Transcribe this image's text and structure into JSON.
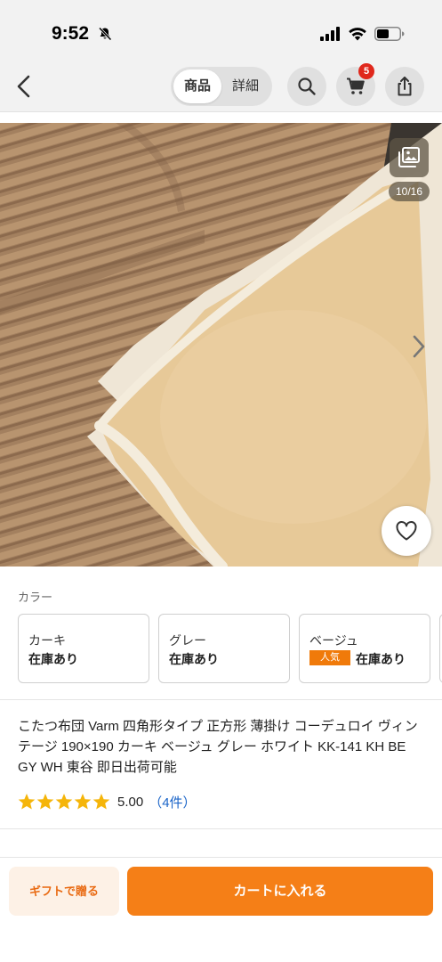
{
  "status_bar": {
    "time": "9:52"
  },
  "nav": {
    "tabs": [
      {
        "label": "商品",
        "active": true
      },
      {
        "label": "詳細",
        "active": false
      }
    ],
    "cart_badge": "5"
  },
  "gallery": {
    "counter": "10/16"
  },
  "colors": {
    "label": "カラー",
    "options": [
      {
        "name": "カーキ",
        "stock": "在庫あり",
        "badge": ""
      },
      {
        "name": "グレー",
        "stock": "在庫あり",
        "badge": ""
      },
      {
        "name": "ベージュ",
        "stock": "在庫あり",
        "badge": "人気"
      }
    ]
  },
  "product": {
    "title": "こたつ布団 Varm 四角形タイプ 正方形 薄掛け コーデュロイ ヴィンテージ 190×190 カーキ ベージュ グレー ホワイト KK-141 KH BE GY WH 東谷 即日出荷可能",
    "rating": {
      "stars": 5,
      "value": "5.00",
      "count": "（4件）"
    }
  },
  "actions": {
    "gift_label": "ギフトで贈る",
    "cart_label": "カートに入れる"
  },
  "icons": [
    "bell-slash-icon",
    "signal-icon",
    "wifi-icon",
    "battery-icon",
    "back-icon",
    "search-icon",
    "cart-icon",
    "share-icon",
    "gallery-icon",
    "chevron-right-icon",
    "heart-icon",
    "star-icon"
  ],
  "colors_theme": {
    "accent": "#f57f17",
    "badge_red": "#e0281c",
    "link_blue": "#1a64c8",
    "star_yellow": "#f5b50a"
  }
}
